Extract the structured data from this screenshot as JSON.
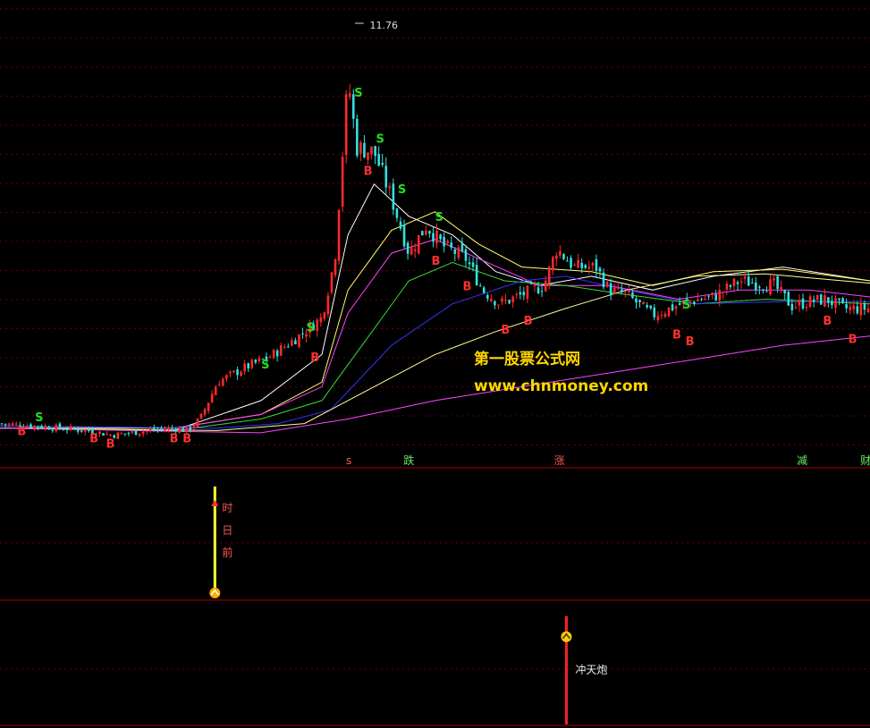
{
  "watermark": {
    "line1": "第一股票公式网",
    "line2": "www.chnmoney.com"
  },
  "colors": {
    "up": "#ff2a2a",
    "down": "#33e0e0",
    "buy_marker": "#ff3030",
    "sell_marker": "#22dd22",
    "ma_colors": [
      "#ffffff",
      "#ffff66",
      "#ff44ff",
      "#33dd33",
      "#3333ff",
      "#ffff99",
      "#ff44ff"
    ],
    "separator": "#aa0000",
    "grid": "#6a0000"
  },
  "chart_data": [
    {
      "type": "candlestick",
      "name": "main",
      "peak_label": "11.76",
      "price_path": [
        {
          "x": 0.0,
          "p": 3.1
        },
        {
          "x": 0.04,
          "p": 3.05
        },
        {
          "x": 0.1,
          "p": 2.95
        },
        {
          "x": 0.13,
          "p": 2.85
        },
        {
          "x": 0.17,
          "p": 2.95
        },
        {
          "x": 0.2,
          "p": 3.0
        },
        {
          "x": 0.215,
          "p": 2.95
        },
        {
          "x": 0.23,
          "p": 3.2
        },
        {
          "x": 0.25,
          "p": 4.0
        },
        {
          "x": 0.28,
          "p": 4.3
        },
        {
          "x": 0.31,
          "p": 4.55
        },
        {
          "x": 0.34,
          "p": 4.95
        },
        {
          "x": 0.37,
          "p": 5.4
        },
        {
          "x": 0.385,
          "p": 6.7
        },
        {
          "x": 0.4,
          "p": 10.6
        },
        {
          "x": 0.41,
          "p": 9.1
        },
        {
          "x": 0.43,
          "p": 9.0
        },
        {
          "x": 0.45,
          "p": 8.0
        },
        {
          "x": 0.47,
          "p": 6.8
        },
        {
          "x": 0.49,
          "p": 7.4
        },
        {
          "x": 0.51,
          "p": 6.95
        },
        {
          "x": 0.535,
          "p": 6.7
        },
        {
          "x": 0.555,
          "p": 6.0
        },
        {
          "x": 0.575,
          "p": 5.7
        },
        {
          "x": 0.6,
          "p": 5.9
        },
        {
          "x": 0.625,
          "p": 6.1
        },
        {
          "x": 0.64,
          "p": 6.9
        },
        {
          "x": 0.66,
          "p": 6.5
        },
        {
          "x": 0.685,
          "p": 6.5
        },
        {
          "x": 0.7,
          "p": 6.0
        },
        {
          "x": 0.72,
          "p": 5.9
        },
        {
          "x": 0.75,
          "p": 5.45
        },
        {
          "x": 0.77,
          "p": 5.6
        },
        {
          "x": 0.79,
          "p": 5.75
        },
        {
          "x": 0.82,
          "p": 5.85
        },
        {
          "x": 0.85,
          "p": 6.2
        },
        {
          "x": 0.89,
          "p": 6.1
        },
        {
          "x": 0.91,
          "p": 5.65
        },
        {
          "x": 0.93,
          "p": 5.75
        },
        {
          "x": 0.95,
          "p": 5.8
        },
        {
          "x": 0.97,
          "p": 5.6
        },
        {
          "x": 1.0,
          "p": 5.6
        }
      ],
      "ma_curves": [
        {
          "name": "",
          "color_index": 0,
          "points": [
            [
              0.0,
              3.0
            ],
            [
              0.2,
              2.95
            ],
            [
              0.3,
              3.6
            ],
            [
              0.37,
              4.6
            ],
            [
              0.4,
              7.2
            ],
            [
              0.43,
              8.3
            ],
            [
              0.47,
              7.6
            ],
            [
              0.52,
              7.2
            ],
            [
              0.57,
              6.4
            ],
            [
              0.62,
              6.1
            ],
            [
              0.68,
              6.3
            ],
            [
              0.75,
              6.0
            ],
            [
              0.82,
              6.3
            ],
            [
              0.9,
              6.5
            ],
            [
              1.0,
              6.2
            ]
          ]
        },
        {
          "name": "",
          "color_index": 1,
          "points": [
            [
              0.0,
              3.0
            ],
            [
              0.2,
              3.0
            ],
            [
              0.3,
              3.3
            ],
            [
              0.37,
              4.0
            ],
            [
              0.4,
              6.0
            ],
            [
              0.45,
              7.3
            ],
            [
              0.5,
              7.7
            ],
            [
              0.55,
              7.0
            ],
            [
              0.6,
              6.5
            ],
            [
              0.68,
              6.4
            ],
            [
              0.75,
              6.1
            ],
            [
              0.82,
              6.4
            ],
            [
              0.9,
              6.45
            ],
            [
              1.0,
              6.2
            ]
          ]
        },
        {
          "name": "",
          "color_index": 2,
          "points": [
            [
              0.0,
              3.05
            ],
            [
              0.2,
              3.0
            ],
            [
              0.3,
              3.3
            ],
            [
              0.37,
              3.9
            ],
            [
              0.4,
              5.5
            ],
            [
              0.45,
              6.8
            ],
            [
              0.5,
              7.1
            ],
            [
              0.56,
              6.6
            ],
            [
              0.62,
              6.1
            ],
            [
              0.7,
              6.1
            ],
            [
              0.78,
              5.8
            ],
            [
              0.85,
              6.0
            ],
            [
              0.93,
              6.0
            ],
            [
              1.0,
              5.85
            ]
          ]
        },
        {
          "name": "",
          "color_index": 3,
          "points": [
            [
              0.0,
              3.05
            ],
            [
              0.22,
              3.0
            ],
            [
              0.3,
              3.2
            ],
            [
              0.37,
              3.6
            ],
            [
              0.42,
              4.9
            ],
            [
              0.47,
              6.2
            ],
            [
              0.52,
              6.6
            ],
            [
              0.58,
              6.2
            ],
            [
              0.65,
              6.1
            ],
            [
              0.72,
              5.9
            ],
            [
              0.8,
              5.7
            ],
            [
              0.88,
              5.8
            ],
            [
              1.0,
              5.7
            ]
          ]
        },
        {
          "name": "",
          "color_index": 4,
          "points": [
            [
              0.0,
              3.05
            ],
            [
              0.25,
              3.0
            ],
            [
              0.32,
              3.1
            ],
            [
              0.38,
              3.4
            ],
            [
              0.45,
              4.8
            ],
            [
              0.52,
              5.7
            ],
            [
              0.6,
              6.2
            ],
            [
              0.65,
              6.3
            ],
            [
              0.72,
              6.0
            ],
            [
              0.8,
              5.7
            ],
            [
              0.9,
              5.75
            ],
            [
              1.0,
              5.75
            ]
          ]
        },
        {
          "name": "",
          "color_index": 5,
          "points": [
            [
              0.0,
              3.0
            ],
            [
              0.25,
              2.95
            ],
            [
              0.35,
              3.1
            ],
            [
              0.42,
              3.8
            ],
            [
              0.5,
              4.6
            ],
            [
              0.57,
              5.1
            ],
            [
              0.65,
              5.6
            ],
            [
              0.72,
              6.0
            ],
            [
              0.8,
              6.3
            ],
            [
              0.88,
              6.35
            ],
            [
              1.0,
              6.15
            ]
          ]
        },
        {
          "name": "",
          "color_index": 6,
          "points": [
            [
              0.0,
              3.0
            ],
            [
              0.3,
              2.9
            ],
            [
              0.4,
              3.2
            ],
            [
              0.5,
              3.6
            ],
            [
              0.6,
              3.9
            ],
            [
              0.7,
              4.2
            ],
            [
              0.8,
              4.5
            ],
            [
              0.9,
              4.8
            ],
            [
              1.0,
              5.0
            ]
          ]
        }
      ],
      "buy_signals": [
        {
          "x": 0.025,
          "p": 2.85
        },
        {
          "x": 0.108,
          "p": 2.7
        },
        {
          "x": 0.127,
          "p": 2.58
        },
        {
          "x": 0.2,
          "p": 2.7
        },
        {
          "x": 0.215,
          "p": 2.7
        },
        {
          "x": 0.362,
          "p": 4.45
        },
        {
          "x": 0.423,
          "p": 8.5
        },
        {
          "x": 0.501,
          "p": 6.55
        },
        {
          "x": 0.537,
          "p": 6.0
        },
        {
          "x": 0.581,
          "p": 5.05
        },
        {
          "x": 0.607,
          "p": 5.25
        },
        {
          "x": 0.778,
          "p": 4.95
        },
        {
          "x": 0.793,
          "p": 4.8
        },
        {
          "x": 0.951,
          "p": 5.25
        },
        {
          "x": 0.98,
          "p": 4.85
        }
      ],
      "sell_signals": [
        {
          "x": 0.045,
          "p": 3.15
        },
        {
          "x": 0.305,
          "p": 4.3
        },
        {
          "x": 0.357,
          "p": 5.1
        },
        {
          "x": 0.412,
          "p": 10.2
        },
        {
          "x": 0.437,
          "p": 9.2
        },
        {
          "x": 0.462,
          "p": 8.1
        },
        {
          "x": 0.505,
          "p": 7.5
        },
        {
          "x": 0.789,
          "p": 5.6
        }
      ],
      "bottom_labels": [
        {
          "x": 0.401,
          "text": "s"
        },
        {
          "x": 0.47,
          "text": "跌"
        },
        {
          "x": 0.643,
          "text": "涨"
        },
        {
          "x": 0.922,
          "text": "减"
        },
        {
          "x": 0.995,
          "text": "财"
        }
      ]
    },
    {
      "type": "indicator",
      "name": "pane2",
      "signal": {
        "x": 0.247,
        "value": 1.0,
        "text_chars": [
          "时",
          "日",
          "前"
        ]
      }
    },
    {
      "type": "indicator",
      "name": "pane3",
      "signal": {
        "x": 0.651,
        "value": 1.0,
        "text": "冲天炮"
      }
    }
  ]
}
